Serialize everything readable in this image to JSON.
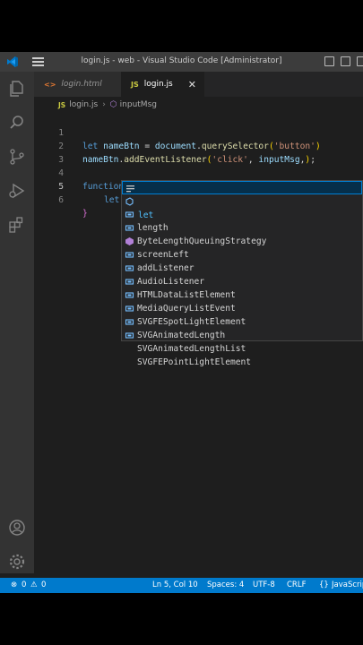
{
  "window": {
    "title": "login.js - web - Visual Studio Code [Administrator]"
  },
  "activity_bar": {
    "icons": [
      "files-icon",
      "search-icon",
      "source-control-icon",
      "run-debug-icon",
      "extensions-icon",
      "account-icon",
      "settings-gear-icon"
    ]
  },
  "tabs": [
    {
      "label": "login.html",
      "icon": "<>",
      "icon_color": "#e37933"
    },
    {
      "label": "login.js",
      "icon": "JS",
      "icon_color": "#cbcb41"
    }
  ],
  "breadcrumb": {
    "file": "login.js",
    "symbol": "inputMsg"
  },
  "editor": {
    "lines": [
      {
        "n": "1"
      },
      {
        "n": "2"
      },
      {
        "n": "3"
      },
      {
        "n": "4"
      },
      {
        "n": "5"
      },
      {
        "n": "6"
      }
    ]
  },
  "suggestions": [
    {
      "label": "let",
      "kind": "keyword-icon"
    },
    {
      "label": "length",
      "kind": "field-icon"
    },
    {
      "label": "ByteLengthQueuingStrategy",
      "kind": "variable-icon"
    },
    {
      "label": "screenLeft",
      "kind": "variable-icon"
    },
    {
      "label": "addListener",
      "kind": "method-icon"
    },
    {
      "label": "AudioListener",
      "kind": "variable-icon"
    },
    {
      "label": "HTMLDataListElement",
      "kind": "variable-icon"
    },
    {
      "label": "MediaQueryListEvent",
      "kind": "variable-icon"
    },
    {
      "label": "SVGFESpotLightElement",
      "kind": "variable-icon"
    },
    {
      "label": "SVGAnimatedLength",
      "kind": "variable-icon"
    },
    {
      "label": "SVGAnimatedLengthList",
      "kind": "variable-icon"
    },
    {
      "label": "SVGFEPointLightElement",
      "kind": "variable-icon"
    }
  ],
  "status_bar": {
    "errors": "0",
    "warnings": "0",
    "position": "Ln 5, Col 10",
    "spaces": "Spaces: 4",
    "encoding": "UTF-8",
    "eol": "CRLF",
    "language": "JavaScript"
  },
  "colors": {
    "status_bar": "#007acc",
    "selected_suggestion": "#062f4a"
  }
}
